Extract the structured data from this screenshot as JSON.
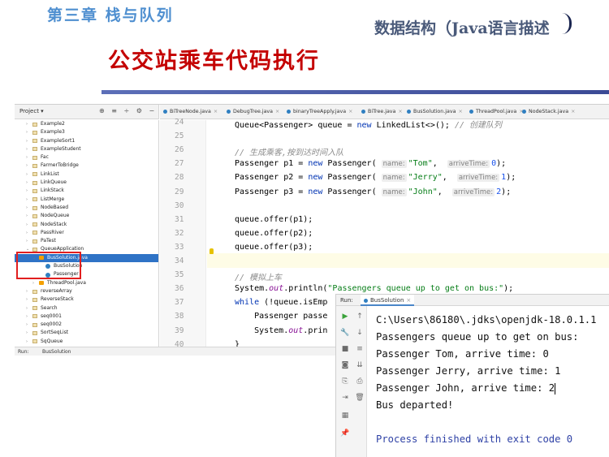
{
  "slide": {
    "chapter": "第三章   栈与队列",
    "book": "数据结构（Java语言描述",
    "title": "公交站乘车代码执行"
  },
  "project_panel": {
    "title": "Project ▾",
    "tree": [
      {
        "label": "Example2",
        "kind": "folder",
        "depth": 1,
        "expanded": false
      },
      {
        "label": "Example3",
        "kind": "folder",
        "depth": 1,
        "expanded": false
      },
      {
        "label": "ExampleSort1",
        "kind": "folder",
        "depth": 1,
        "expanded": false
      },
      {
        "label": "ExampleStudent",
        "kind": "folder",
        "depth": 1,
        "expanded": false
      },
      {
        "label": "Fac",
        "kind": "folder",
        "depth": 1,
        "expanded": false
      },
      {
        "label": "FarmerToBridge",
        "kind": "folder",
        "depth": 1,
        "expanded": false
      },
      {
        "label": "LinkList",
        "kind": "folder",
        "depth": 1,
        "expanded": false
      },
      {
        "label": "LinkQueue",
        "kind": "folder",
        "depth": 1,
        "expanded": false
      },
      {
        "label": "LinkStack",
        "kind": "folder",
        "depth": 1,
        "expanded": false
      },
      {
        "label": "ListMerge",
        "kind": "folder",
        "depth": 1,
        "expanded": false
      },
      {
        "label": "NodeBased",
        "kind": "folder",
        "depth": 1,
        "expanded": false
      },
      {
        "label": "NodeQueue",
        "kind": "folder",
        "depth": 1,
        "expanded": false
      },
      {
        "label": "NodeStack",
        "kind": "folder",
        "depth": 1,
        "expanded": false
      },
      {
        "label": "PassRiver",
        "kind": "folder",
        "depth": 1,
        "expanded": false
      },
      {
        "label": "PaTest",
        "kind": "folder",
        "depth": 1,
        "expanded": false
      },
      {
        "label": "QueueApplication",
        "kind": "folder",
        "depth": 1,
        "expanded": true
      },
      {
        "label": "BusSolution.java",
        "kind": "java",
        "depth": 2,
        "expanded": true,
        "selected": true
      },
      {
        "label": "BusSolution",
        "kind": "cls",
        "depth": 3
      },
      {
        "label": "Passenger",
        "kind": "cls",
        "depth": 3
      },
      {
        "label": "ThreadPool.java",
        "kind": "java",
        "depth": 2,
        "expanded": false
      },
      {
        "label": "reverseArray",
        "kind": "folder",
        "depth": 1,
        "expanded": false
      },
      {
        "label": "ReverseStack",
        "kind": "folder",
        "depth": 1,
        "expanded": false
      },
      {
        "label": "Search",
        "kind": "folder",
        "depth": 1,
        "expanded": false
      },
      {
        "label": "seq0001",
        "kind": "folder",
        "depth": 1,
        "expanded": false
      },
      {
        "label": "seq0002",
        "kind": "folder",
        "depth": 1,
        "expanded": false
      },
      {
        "label": "SortSeqList",
        "kind": "folder",
        "depth": 1,
        "expanded": false
      },
      {
        "label": "SqQueue",
        "kind": "folder",
        "depth": 1,
        "expanded": false
      }
    ]
  },
  "editor_tabs": [
    "BiTreeNode.java",
    "DebugTree.java",
    "binaryTreeApply.java",
    "BiTree.java",
    "BusSolution.java",
    "ThreadPool.java",
    "NodeStack.java"
  ],
  "line_numbers": [
    "24",
    "25",
    "26",
    "27",
    "28",
    "29",
    "30",
    "31",
    "32",
    "33",
    "34",
    "35",
    "36",
    "37",
    "38",
    "39",
    "40"
  ],
  "code_lines": [
    {
      "n": "24",
      "segs": [
        [
          "",
          "Queue<Passenger> queue = "
        ],
        [
          "kw",
          "new"
        ],
        [
          "",
          " LinkedList<>(); "
        ],
        [
          "cm",
          "// 创建队列"
        ]
      ]
    },
    {
      "n": "25",
      "segs": []
    },
    {
      "n": "26",
      "segs": [
        [
          "cm",
          "// 生成乘客,按到达时间入队"
        ]
      ]
    },
    {
      "n": "27",
      "segs": [
        [
          "",
          "Passenger p1 = "
        ],
        [
          "kw",
          "new"
        ],
        [
          "",
          " Passenger( "
        ],
        [
          "hint",
          "name:"
        ],
        [
          "st",
          "\"Tom\""
        ],
        [
          "",
          ",  "
        ],
        [
          "hint",
          "arriveTime:"
        ],
        [
          "nm",
          "0"
        ],
        [
          "",
          ");"
        ]
      ]
    },
    {
      "n": "28",
      "segs": [
        [
          "",
          "Passenger p2 = "
        ],
        [
          "kw",
          "new"
        ],
        [
          "",
          " Passenger( "
        ],
        [
          "hint",
          "name:"
        ],
        [
          "st",
          "\"Jerry\""
        ],
        [
          "",
          ",  "
        ],
        [
          "hint",
          "arriveTime:"
        ],
        [
          "nm",
          "1"
        ],
        [
          "",
          ");"
        ]
      ]
    },
    {
      "n": "29",
      "segs": [
        [
          "",
          "Passenger p3 = "
        ],
        [
          "kw",
          "new"
        ],
        [
          "",
          " Passenger( "
        ],
        [
          "hint",
          "name:"
        ],
        [
          "st",
          "\"John\""
        ],
        [
          "",
          ",  "
        ],
        [
          "hint",
          "arriveTime:"
        ],
        [
          "nm",
          "2"
        ],
        [
          "",
          ");"
        ]
      ]
    },
    {
      "n": "30",
      "segs": []
    },
    {
      "n": "31",
      "segs": [
        [
          "",
          "queue.offer(p1);"
        ]
      ]
    },
    {
      "n": "32",
      "segs": [
        [
          "",
          "queue.offer(p2);"
        ]
      ]
    },
    {
      "n": "33",
      "segs": [
        [
          "",
          "queue.offer(p3);"
        ]
      ]
    },
    {
      "n": "34",
      "segs": []
    },
    {
      "n": "35",
      "segs": [
        [
          "cm",
          "// 模拟上车"
        ]
      ]
    },
    {
      "n": "36",
      "segs": [
        [
          "",
          "System."
        ],
        [
          "fld",
          "out"
        ],
        [
          "",
          ".println("
        ],
        [
          "st",
          "\"Passengers queue up to get on bus:\""
        ],
        [
          "",
          ");"
        ]
      ]
    },
    {
      "n": "37",
      "segs": [
        [
          "kw",
          "while"
        ],
        [
          "",
          " (!queue.isEmp"
        ]
      ]
    },
    {
      "n": "38",
      "segs": [
        [
          "",
          "    Passenger passe"
        ]
      ]
    },
    {
      "n": "39",
      "segs": [
        [
          "",
          "    System."
        ],
        [
          "fld",
          "out"
        ],
        [
          "",
          ".prin"
        ]
      ]
    },
    {
      "n": "40",
      "segs": [
        [
          "",
          "}"
        ]
      ]
    }
  ],
  "bottom_bar": {
    "run_label": "Run:",
    "run_tab": "BusSolution"
  },
  "run_panel": {
    "label": "Run:",
    "tab": "BusSolution",
    "console_lines": [
      "C:\\Users\\86180\\.jdks\\openjdk-18.0.1.1",
      "Passengers queue up to get on bus:",
      "Passenger Tom, arrive time: 0",
      "Passenger Jerry, arrive time: 1",
      "Passenger John, arrive time: 2",
      "Bus departed!",
      "",
      "Process finished with exit code 0"
    ]
  },
  "colors": {
    "title_red": "#c40000",
    "chapter_blue": "#4f8fd0",
    "selection": "#2f73c6",
    "highlight_box": "#e11f1f"
  }
}
